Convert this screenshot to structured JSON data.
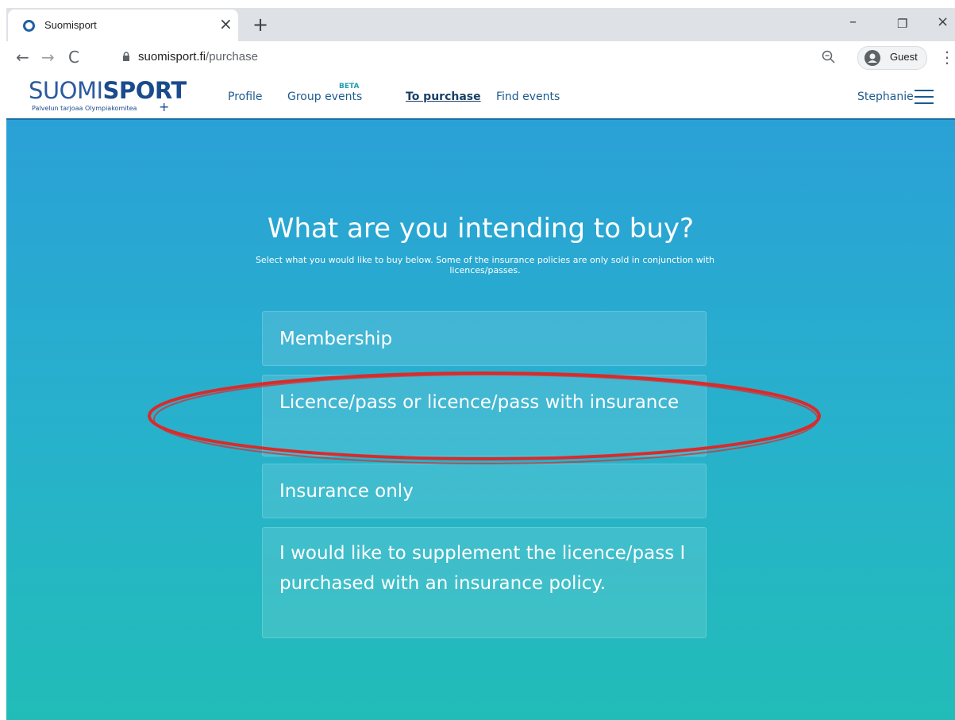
{
  "browser": {
    "tab_title": "Suomisport",
    "tab_close": "×",
    "new_tab": "+",
    "url_host": "suomisport.fi",
    "url_path": "/purchase",
    "profile_label": "Guest",
    "controls": {
      "minimize": "–",
      "restore": "❐",
      "close": "×",
      "back": "←",
      "forward": "→",
      "reload": "C",
      "menu": "⋮"
    }
  },
  "site": {
    "logo_suomi": "SUOMI",
    "logo_sport": "SPORT",
    "logo_tagline": "Palvelun tarjoaa Olympiakomitea",
    "logo_cross": "+",
    "nav": {
      "profile": "Profile",
      "group_events": "Group events",
      "beta": "BETA",
      "to_purchase": "To purchase",
      "find_events": "Find events"
    },
    "user_name": "Stephanie"
  },
  "main": {
    "heading": "What are you intending to buy?",
    "subtext": "Select what you would like to buy below. Some of the insurance policies are only sold in conjunction with licences/passes.",
    "options": [
      {
        "label": "Membership"
      },
      {
        "label": "Licence/pass or licence/pass with insurance",
        "highlighted": true
      },
      {
        "label": "Insurance only"
      },
      {
        "label": "I would like to supplement the licence/pass I purchased with an insurance policy."
      }
    ]
  },
  "colors": {
    "brand_blue": "#1a4b8c",
    "gradient_top": "#2aa1d6",
    "gradient_bottom": "#22bcb8",
    "annotation_red": "#d92b2b"
  },
  "icons": {
    "favicon": "suomisport-ring-icon",
    "lock": "lock-icon",
    "zoom": "zoom-icon",
    "avatar": "account-avatar-icon",
    "menu": "hamburger-menu-icon"
  }
}
